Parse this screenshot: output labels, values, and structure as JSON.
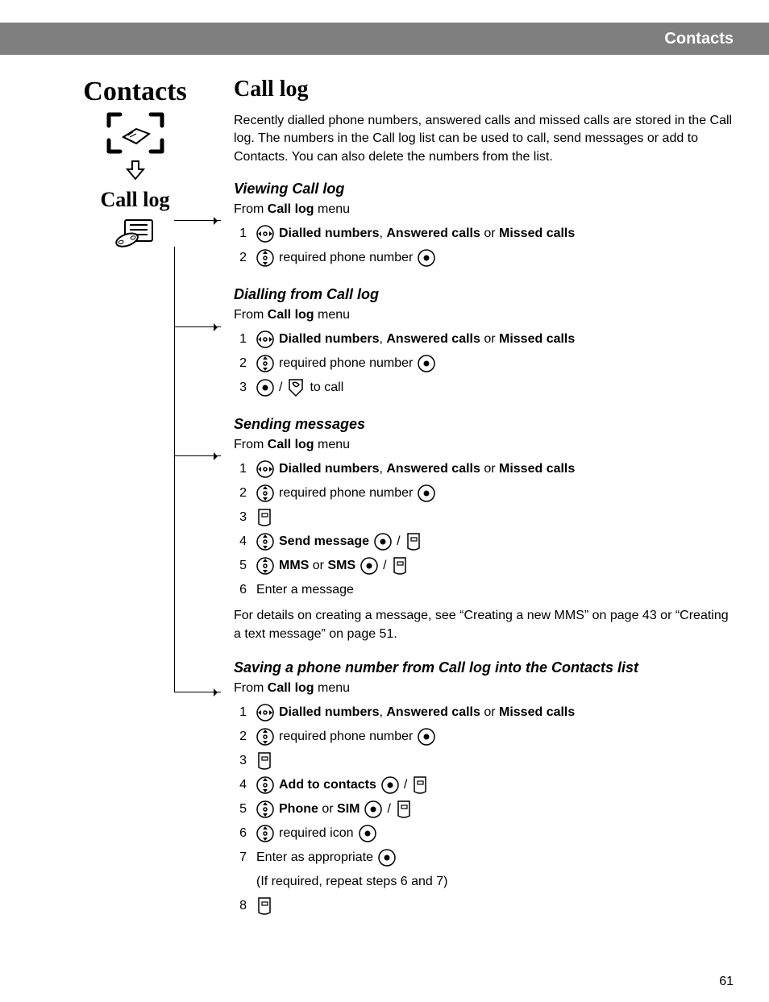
{
  "header": {
    "title": "Contacts"
  },
  "leftcol": {
    "title": "Contacts",
    "sub": "Call log"
  },
  "main": {
    "heading": "Call log",
    "intro": "Recently dialled phone numbers, answered calls and missed calls are stored in the Call log. The numbers in the Call log list can be used to call, send messages or add to Contacts. You can also delete the numbers from the list."
  },
  "sec_view": {
    "title": "Viewing Call log",
    "from_pre": "From ",
    "from_bold": "Call log",
    "from_post": " menu",
    "s1_bold_a": "Dialled numbers",
    "s1_sep1": ", ",
    "s1_bold_b": "Answered calls",
    "s1_sep2": " or ",
    "s1_bold_c": "Missed calls",
    "s2_text": " required phone number "
  },
  "sec_dial": {
    "title": "Dialling from Call log",
    "from_pre": "From ",
    "from_bold": "Call log",
    "from_post": " menu",
    "s3_sep": " / ",
    "s3_post": " to call"
  },
  "sec_msg": {
    "title": "Sending messages",
    "from_pre": "From ",
    "from_bold": "Call log",
    "from_post": " menu",
    "s4_bold": "Send message",
    "s4_sep": " / ",
    "s5_bold_a": "MMS",
    "s5_or": " or ",
    "s5_bold_b": "SMS",
    "s5_sep": " / ",
    "s6_text": "Enter a message",
    "note": "For details on creating a message, see “Creating a new MMS” on page 43 or “Creating a text message” on page 51."
  },
  "sec_save": {
    "title": "Saving a phone number from Call log into the Contacts list",
    "from_pre": "From ",
    "from_bold": "Call log",
    "from_post": " menu",
    "s4_bold": "Add to contacts",
    "s4_sep": " / ",
    "s5_bold_a": "Phone",
    "s5_or": " or ",
    "s5_bold_b": "SIM",
    "s5_sep": " / ",
    "s6_text": " required icon ",
    "s7_text": "Enter as appropriate ",
    "s7_note": "(If required, repeat steps 6 and 7)"
  },
  "step_numbers": {
    "n1": "1",
    "n2": "2",
    "n3": "3",
    "n4": "4",
    "n5": "5",
    "n6": "6",
    "n7": "7",
    "n8": "8"
  },
  "page_number": "61"
}
